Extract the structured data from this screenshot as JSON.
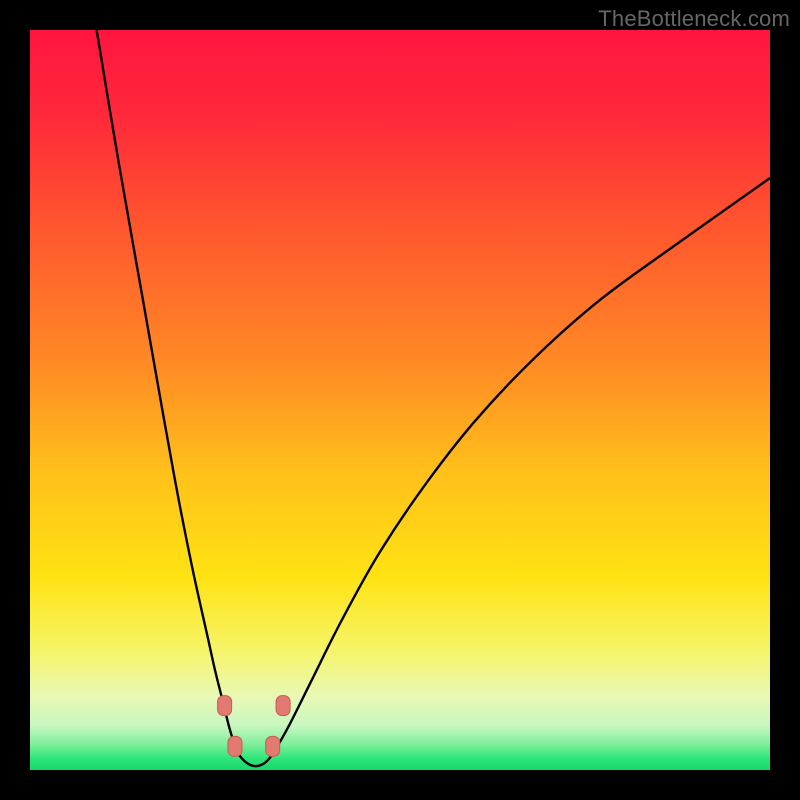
{
  "watermark": "TheBottleneck.com",
  "colors": {
    "frame": "#000000",
    "curve": "#000000",
    "dots_fill": "#e37a72",
    "dots_stroke": "#c45b52",
    "gradient_stops": [
      {
        "offset": 0.0,
        "color": "#ff153f"
      },
      {
        "offset": 0.12,
        "color": "#ff2a3a"
      },
      {
        "offset": 0.28,
        "color": "#ff5a2d"
      },
      {
        "offset": 0.45,
        "color": "#ff8a25"
      },
      {
        "offset": 0.6,
        "color": "#ffc11a"
      },
      {
        "offset": 0.74,
        "color": "#ffe313"
      },
      {
        "offset": 0.84,
        "color": "#f5f56a"
      },
      {
        "offset": 0.9,
        "color": "#e9f8b5"
      },
      {
        "offset": 0.94,
        "color": "#c8f7c0"
      },
      {
        "offset": 0.965,
        "color": "#7fef9a"
      },
      {
        "offset": 0.985,
        "color": "#2de578"
      },
      {
        "offset": 1.0,
        "color": "#17d86a"
      }
    ]
  },
  "chart_data": {
    "type": "line",
    "title": "",
    "xlabel": "",
    "ylabel": "",
    "x_range": [
      0,
      100
    ],
    "y_range": [
      0,
      100
    ],
    "description": "Bottleneck-style V curve; minimum near x≈27–33, y≈0–3. Left branch rises steeply to 100 at x≈9; right branch rises concavely to ≈80 at x=100.",
    "series": [
      {
        "name": "left-branch",
        "x": [
          9.0,
          12.0,
          15.0,
          18.0,
          20.0,
          22.0,
          24.0,
          25.0,
          26.0,
          27.0,
          28.0
        ],
        "y": [
          100.0,
          82.0,
          65.0,
          48.0,
          37.0,
          27.0,
          18.0,
          13.5,
          9.5,
          5.5,
          2.5
        ]
      },
      {
        "name": "floor",
        "x": [
          28.0,
          29.0,
          30.0,
          31.0,
          32.0,
          33.0
        ],
        "y": [
          2.5,
          1.2,
          0.6,
          0.6,
          1.2,
          2.5
        ]
      },
      {
        "name": "right-branch",
        "x": [
          33.0,
          35.0,
          38.0,
          42.0,
          47.0,
          53.0,
          60.0,
          68.0,
          77.0,
          88.0,
          100.0
        ],
        "y": [
          2.5,
          6.0,
          12.0,
          20.0,
          29.0,
          38.0,
          47.0,
          55.5,
          63.5,
          71.5,
          80.0
        ]
      }
    ],
    "marker_dots": [
      {
        "x": 26.3,
        "y": 8.7
      },
      {
        "x": 34.2,
        "y": 8.7
      },
      {
        "x": 27.7,
        "y": 3.2
      },
      {
        "x": 32.8,
        "y": 3.2
      }
    ]
  }
}
